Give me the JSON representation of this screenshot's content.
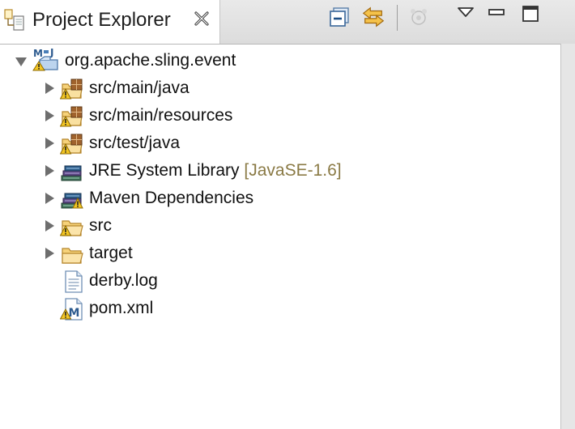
{
  "view": {
    "title": "Project Explorer",
    "colors": {
      "folder": "#f2c35b",
      "package_brown": "#8b5a2b",
      "warning": "#f0c020",
      "decoration": "#8a7a45"
    }
  },
  "tree": {
    "root": {
      "label": "org.apache.sling.event",
      "icon": "maven-project-icon",
      "expanded": true
    },
    "children": [
      {
        "label": "src/main/java",
        "icon": "source-folder-icon"
      },
      {
        "label": "src/main/resources",
        "icon": "source-folder-icon"
      },
      {
        "label": "src/test/java",
        "icon": "source-folder-icon"
      },
      {
        "label": "JRE System Library",
        "decoration": "[JavaSE-1.6]",
        "icon": "library-icon"
      },
      {
        "label": "Maven Dependencies",
        "icon": "library-icon"
      },
      {
        "label": "src",
        "icon": "folder-icon"
      },
      {
        "label": "target",
        "icon": "folder-icon"
      },
      {
        "label": "derby.log",
        "icon": "text-file-icon"
      },
      {
        "label": "pom.xml",
        "icon": "maven-pom-icon"
      }
    ]
  }
}
